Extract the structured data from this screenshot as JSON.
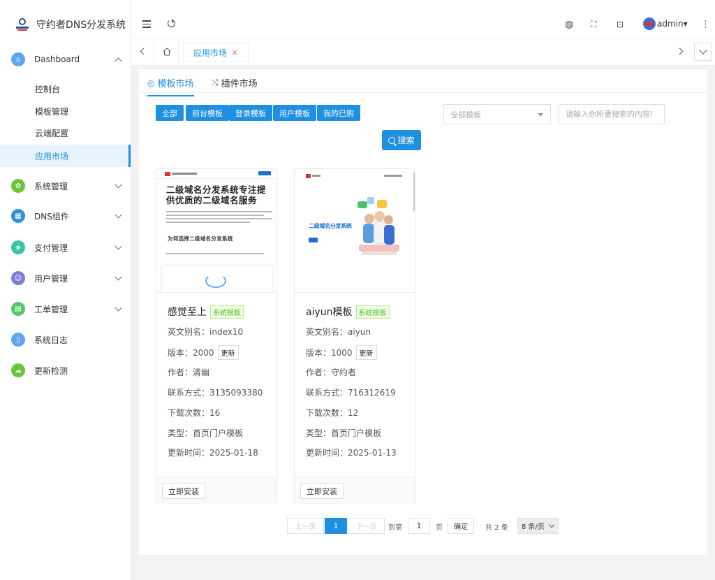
{
  "app": {
    "title": "守约者DNS分发系统"
  },
  "sidebar": {
    "dashboard": {
      "label": "Dashboard",
      "icon": "home-icon",
      "color": "#5fa6f1"
    },
    "sub_items": [
      "控制台",
      "模板管理",
      "云端配置",
      "应用市场"
    ],
    "active_sub": "应用市场",
    "items": [
      {
        "label": "系统管理",
        "icon": "gear-icon",
        "color": "#6ac43a"
      },
      {
        "label": "DNS组件",
        "icon": "dns-icon",
        "color": "#2f8fd8"
      },
      {
        "label": "支付管理",
        "icon": "shield-icon",
        "color": "#39c4a8"
      },
      {
        "label": "用户管理",
        "icon": "user-icon",
        "color": "#7b7fd6"
      },
      {
        "label": "工单管理",
        "icon": "ticket-icon",
        "color": "#5ac46a"
      },
      {
        "label": "系统日志",
        "icon": "log-icon",
        "color": "#5fa6f1"
      },
      {
        "label": "更新检测",
        "icon": "cloud-icon",
        "color": "#6ac43a"
      }
    ]
  },
  "header": {
    "user": "admin"
  },
  "tabbar": {
    "active_tab": "应用市场"
  },
  "content": {
    "tabs": [
      "模板市场",
      "插件市场"
    ],
    "filters": [
      "全部",
      "前台模板",
      "登录模板",
      "用户模板",
      "我的已购"
    ],
    "select": "全部模板",
    "search_placeholder": "请输入你所要搜索的内容!",
    "search_button": "搜索"
  },
  "templates": [
    {
      "name": "感觉至上",
      "tag": "系统模板",
      "alias": "英文别名：index10",
      "version": "版本：2000",
      "update": "更新",
      "author": "作者：清幽",
      "contact": "联系方式：3135093380",
      "downloads": "下载次数：16",
      "type": "类型：首页门户模板",
      "updated": "更新时间：2025-01-18",
      "install": "立即安装",
      "thumb_heading": "二级域名分发系统专注提供优质的二级域名服务",
      "thumb_sub": "为何选择二级域名分发系统"
    },
    {
      "name": "aiyun模板",
      "tag": "系统模板",
      "alias": "英文别名：aiyun",
      "version": "版本：1000",
      "update": "更新",
      "author": "作者：守约者",
      "contact": "联系方式：716312619",
      "downloads": "下载次数：12",
      "type": "类型：首页门户模板",
      "updated": "更新时间：2025-01-13",
      "install": "立即安装",
      "thumb_title": "二级域名分发系统"
    }
  ],
  "pagination": {
    "prev": "上一页",
    "current": "1",
    "next": "下一页",
    "goto_prefix": "到第",
    "goto_value": "1",
    "goto_suffix": "页",
    "confirm": "确定",
    "total": "共 2 条",
    "page_size": "8 条/页"
  }
}
